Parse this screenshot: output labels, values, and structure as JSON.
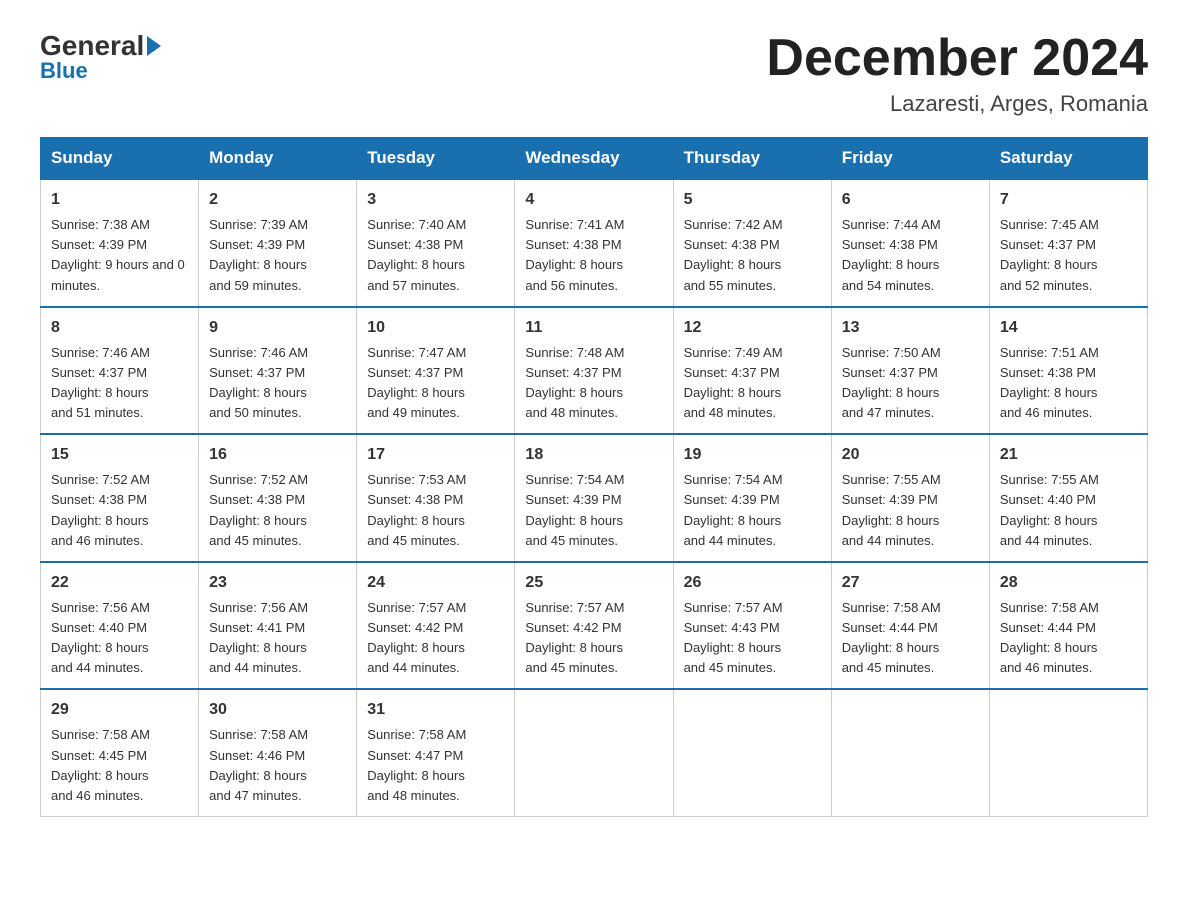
{
  "logo": {
    "general": "General",
    "blue": "Blue"
  },
  "title": "December 2024",
  "location": "Lazaresti, Arges, Romania",
  "days_of_week": [
    "Sunday",
    "Monday",
    "Tuesday",
    "Wednesday",
    "Thursday",
    "Friday",
    "Saturday"
  ],
  "weeks": [
    [
      {
        "day": "1",
        "sunrise": "7:38 AM",
        "sunset": "4:39 PM",
        "daylight": "9 hours and 0 minutes."
      },
      {
        "day": "2",
        "sunrise": "7:39 AM",
        "sunset": "4:39 PM",
        "daylight": "8 hours and 59 minutes."
      },
      {
        "day": "3",
        "sunrise": "7:40 AM",
        "sunset": "4:38 PM",
        "daylight": "8 hours and 57 minutes."
      },
      {
        "day": "4",
        "sunrise": "7:41 AM",
        "sunset": "4:38 PM",
        "daylight": "8 hours and 56 minutes."
      },
      {
        "day": "5",
        "sunrise": "7:42 AM",
        "sunset": "4:38 PM",
        "daylight": "8 hours and 55 minutes."
      },
      {
        "day": "6",
        "sunrise": "7:44 AM",
        "sunset": "4:38 PM",
        "daylight": "8 hours and 54 minutes."
      },
      {
        "day": "7",
        "sunrise": "7:45 AM",
        "sunset": "4:37 PM",
        "daylight": "8 hours and 52 minutes."
      }
    ],
    [
      {
        "day": "8",
        "sunrise": "7:46 AM",
        "sunset": "4:37 PM",
        "daylight": "8 hours and 51 minutes."
      },
      {
        "day": "9",
        "sunrise": "7:46 AM",
        "sunset": "4:37 PM",
        "daylight": "8 hours and 50 minutes."
      },
      {
        "day": "10",
        "sunrise": "7:47 AM",
        "sunset": "4:37 PM",
        "daylight": "8 hours and 49 minutes."
      },
      {
        "day": "11",
        "sunrise": "7:48 AM",
        "sunset": "4:37 PM",
        "daylight": "8 hours and 48 minutes."
      },
      {
        "day": "12",
        "sunrise": "7:49 AM",
        "sunset": "4:37 PM",
        "daylight": "8 hours and 48 minutes."
      },
      {
        "day": "13",
        "sunrise": "7:50 AM",
        "sunset": "4:37 PM",
        "daylight": "8 hours and 47 minutes."
      },
      {
        "day": "14",
        "sunrise": "7:51 AM",
        "sunset": "4:38 PM",
        "daylight": "8 hours and 46 minutes."
      }
    ],
    [
      {
        "day": "15",
        "sunrise": "7:52 AM",
        "sunset": "4:38 PM",
        "daylight": "8 hours and 46 minutes."
      },
      {
        "day": "16",
        "sunrise": "7:52 AM",
        "sunset": "4:38 PM",
        "daylight": "8 hours and 45 minutes."
      },
      {
        "day": "17",
        "sunrise": "7:53 AM",
        "sunset": "4:38 PM",
        "daylight": "8 hours and 45 minutes."
      },
      {
        "day": "18",
        "sunrise": "7:54 AM",
        "sunset": "4:39 PM",
        "daylight": "8 hours and 45 minutes."
      },
      {
        "day": "19",
        "sunrise": "7:54 AM",
        "sunset": "4:39 PM",
        "daylight": "8 hours and 44 minutes."
      },
      {
        "day": "20",
        "sunrise": "7:55 AM",
        "sunset": "4:39 PM",
        "daylight": "8 hours and 44 minutes."
      },
      {
        "day": "21",
        "sunrise": "7:55 AM",
        "sunset": "4:40 PM",
        "daylight": "8 hours and 44 minutes."
      }
    ],
    [
      {
        "day": "22",
        "sunrise": "7:56 AM",
        "sunset": "4:40 PM",
        "daylight": "8 hours and 44 minutes."
      },
      {
        "day": "23",
        "sunrise": "7:56 AM",
        "sunset": "4:41 PM",
        "daylight": "8 hours and 44 minutes."
      },
      {
        "day": "24",
        "sunrise": "7:57 AM",
        "sunset": "4:42 PM",
        "daylight": "8 hours and 44 minutes."
      },
      {
        "day": "25",
        "sunrise": "7:57 AM",
        "sunset": "4:42 PM",
        "daylight": "8 hours and 45 minutes."
      },
      {
        "day": "26",
        "sunrise": "7:57 AM",
        "sunset": "4:43 PM",
        "daylight": "8 hours and 45 minutes."
      },
      {
        "day": "27",
        "sunrise": "7:58 AM",
        "sunset": "4:44 PM",
        "daylight": "8 hours and 45 minutes."
      },
      {
        "day": "28",
        "sunrise": "7:58 AM",
        "sunset": "4:44 PM",
        "daylight": "8 hours and 46 minutes."
      }
    ],
    [
      {
        "day": "29",
        "sunrise": "7:58 AM",
        "sunset": "4:45 PM",
        "daylight": "8 hours and 46 minutes."
      },
      {
        "day": "30",
        "sunrise": "7:58 AM",
        "sunset": "4:46 PM",
        "daylight": "8 hours and 47 minutes."
      },
      {
        "day": "31",
        "sunrise": "7:58 AM",
        "sunset": "4:47 PM",
        "daylight": "8 hours and 48 minutes."
      },
      null,
      null,
      null,
      null
    ]
  ],
  "labels": {
    "sunrise": "Sunrise:",
    "sunset": "Sunset:",
    "daylight": "Daylight:"
  }
}
